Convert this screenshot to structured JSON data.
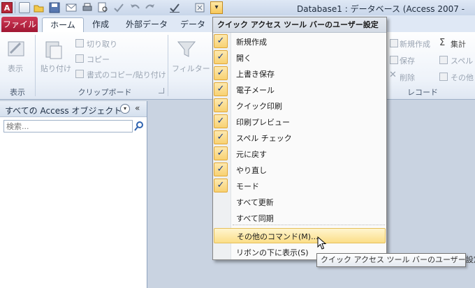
{
  "app": {
    "logo_letter": "A",
    "title": "Database1 : データベース (Access 2007 -"
  },
  "qat": {
    "icons": [
      "access-logo-icon",
      "new-icon",
      "open-icon",
      "save-icon",
      "email-icon",
      "quick-print-icon",
      "print-preview-icon",
      "spelling-icon",
      "undo-icon",
      "redo-icon",
      "mode-icon",
      "customize-icon"
    ],
    "dropdown_glyph": "▾"
  },
  "tabs": {
    "file": "ファイル",
    "items": [
      "ホーム",
      "作成",
      "外部データ",
      "データベ"
    ]
  },
  "ribbon": {
    "view_label": "表示",
    "paste_label": "貼り付け",
    "cut_label": "切り取り",
    "copy_label": "コピー",
    "format_painter_label": "書式のコピー/貼り付け",
    "filter_label": "フィルター",
    "new_record_label": "新規作成",
    "save_record_label": "保存",
    "delete_label": "削除",
    "totals_label": "集計",
    "spelling_label": "スペル",
    "more_label": "その他",
    "groups": {
      "view": "表示",
      "clipboard": "クリップボード",
      "records": "レコード"
    }
  },
  "nav": {
    "title": "すべての Access オブジェクト",
    "chevron": "▾",
    "collapse": "«",
    "search_placeholder": "検索..."
  },
  "menu": {
    "header": "クイック アクセス ツール バーのユーザー設定",
    "items": [
      {
        "label": "新規作成",
        "checked": true
      },
      {
        "label": "開く",
        "checked": true
      },
      {
        "label": "上書き保存",
        "checked": true
      },
      {
        "label": "電子メール",
        "checked": true
      },
      {
        "label": "クイック印刷",
        "checked": true
      },
      {
        "label": "印刷プレビュー",
        "checked": true
      },
      {
        "label": "スペル チェック",
        "checked": true
      },
      {
        "label": "元に戻す",
        "checked": true
      },
      {
        "label": "やり直し",
        "checked": true
      },
      {
        "label": "モード",
        "checked": true
      },
      {
        "label": "すべて更新",
        "checked": false
      },
      {
        "label": "すべて同期",
        "checked": false
      }
    ],
    "more_commands": "その他のコマンド(M)...",
    "show_below": "リボンの下に表示(S)",
    "check_glyph": "✓"
  },
  "tooltip": "クイック アクセス ツール バーのユーザー設定",
  "colors": {
    "file_tab": "#b41f3d",
    "highlight": "#fbde88",
    "check_bg": "#f8d172"
  }
}
